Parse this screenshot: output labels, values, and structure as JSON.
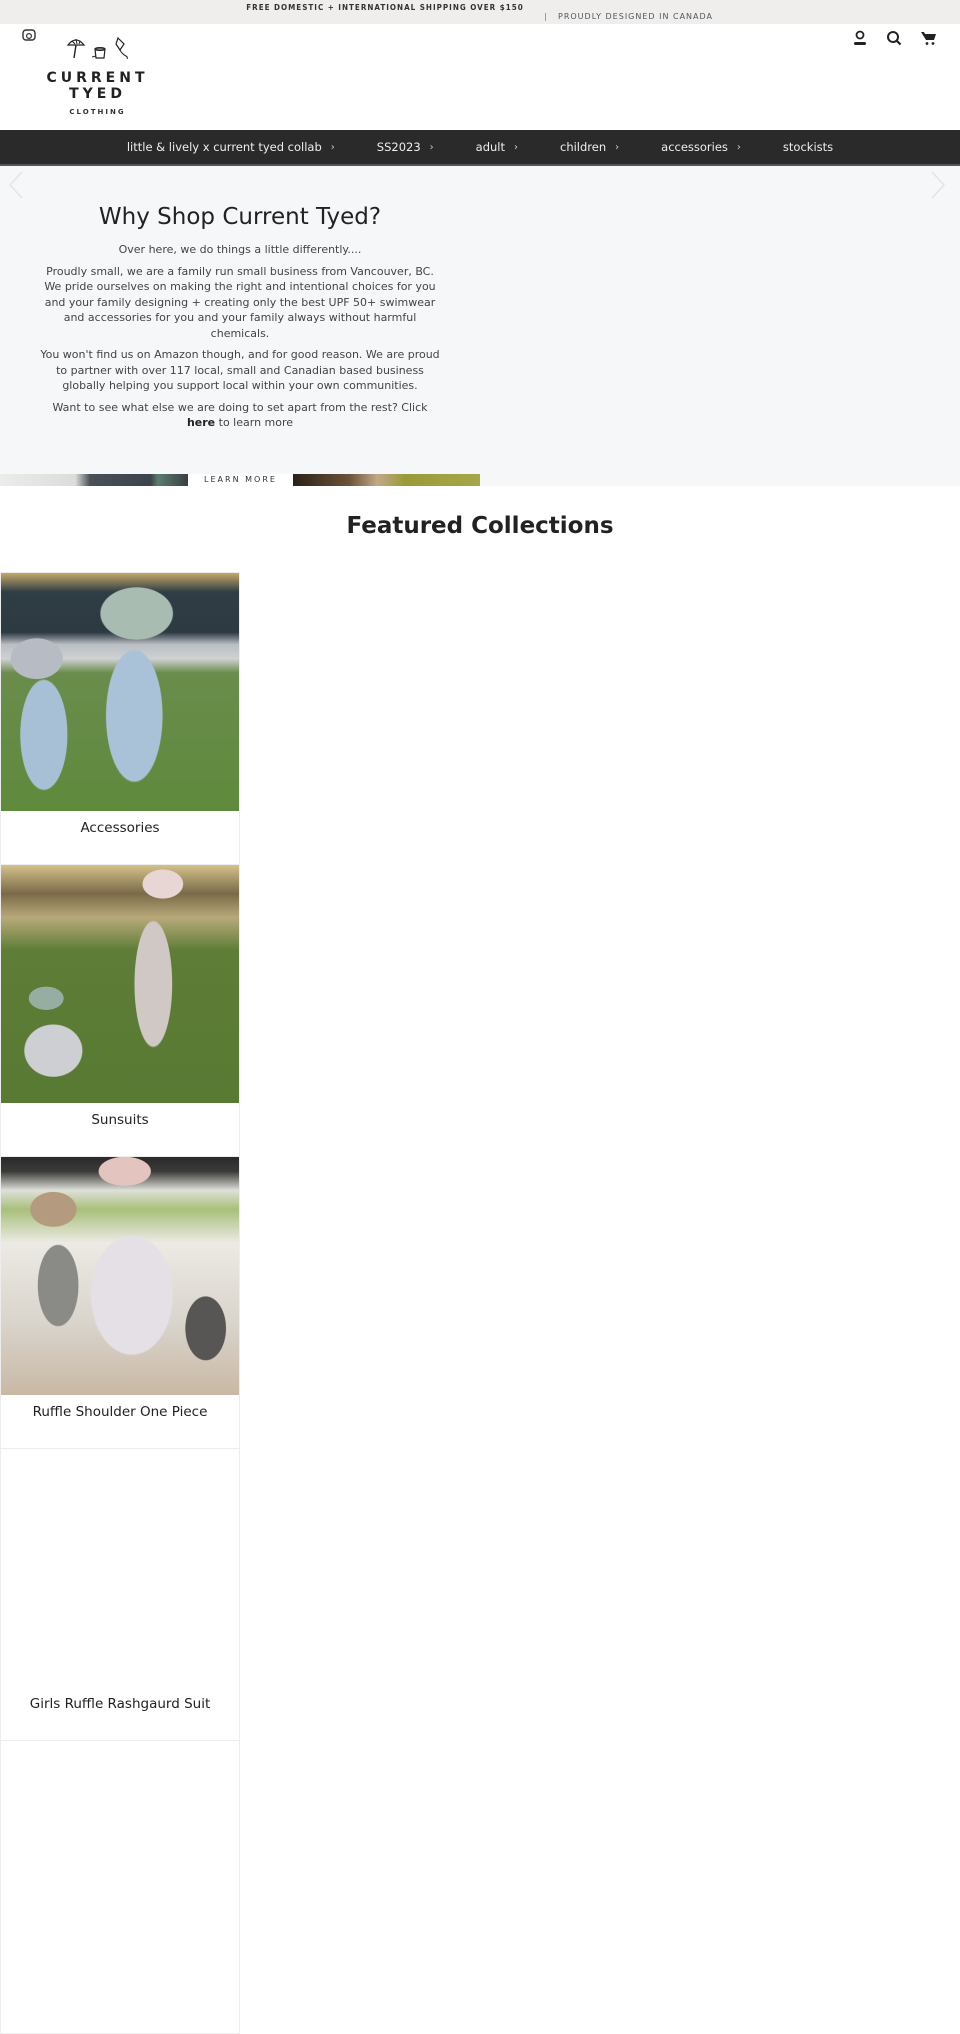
{
  "announcement": {
    "shipping": "FREE DOMESTIC + INTERNATIONAL SHIPPING OVER $150",
    "separator": "|",
    "designed": "PROUDLY DESIGNED IN CANADA"
  },
  "header": {
    "logo": {
      "brand": "CURRENT TYED",
      "sub": "CLOTHING"
    },
    "icons": [
      "instagram-icon",
      "account-icon",
      "search-icon",
      "cart-icon"
    ]
  },
  "nav": {
    "items": [
      {
        "label": "little & lively x current tyed collab",
        "has_children": true
      },
      {
        "label": "SS2023",
        "has_children": true
      },
      {
        "label": "adult",
        "has_children": true
      },
      {
        "label": "children",
        "has_children": true
      },
      {
        "label": "accessories",
        "has_children": true
      },
      {
        "label": "stockists",
        "has_children": false
      }
    ],
    "chevron": "›"
  },
  "hero": {
    "title": "Why Shop Current Tyed?",
    "intro": "Over here, we do things a little differently....",
    "para1": "Proudly small, we are a family run small business from Vancouver, BC. We pride ourselves on making the right and intentional choices for you and your family designing + creating only the best UPF 50+ swimwear and accessories for you and your family always without harmful chemicals.",
    "para2": "You won't find us on Amazon though, and for good reason. We are proud to partner with over 117 local, small and Canadian based business globally helping you support local within your own communities.",
    "para3_before": "Want to see what else we are doing to set apart from the rest? Click",
    "para3_link": "here",
    "para3_after": "to learn more",
    "learn_more": "LEARN MORE"
  },
  "featured": {
    "title": "Featured Collections",
    "collections": [
      {
        "label": "Accessories"
      },
      {
        "label": "Sunsuits"
      },
      {
        "label": "Ruffle Shoulder One Piece"
      },
      {
        "label": "Girls Ruffle Rashgaurd Suit"
      },
      {
        "label": ""
      }
    ]
  }
}
